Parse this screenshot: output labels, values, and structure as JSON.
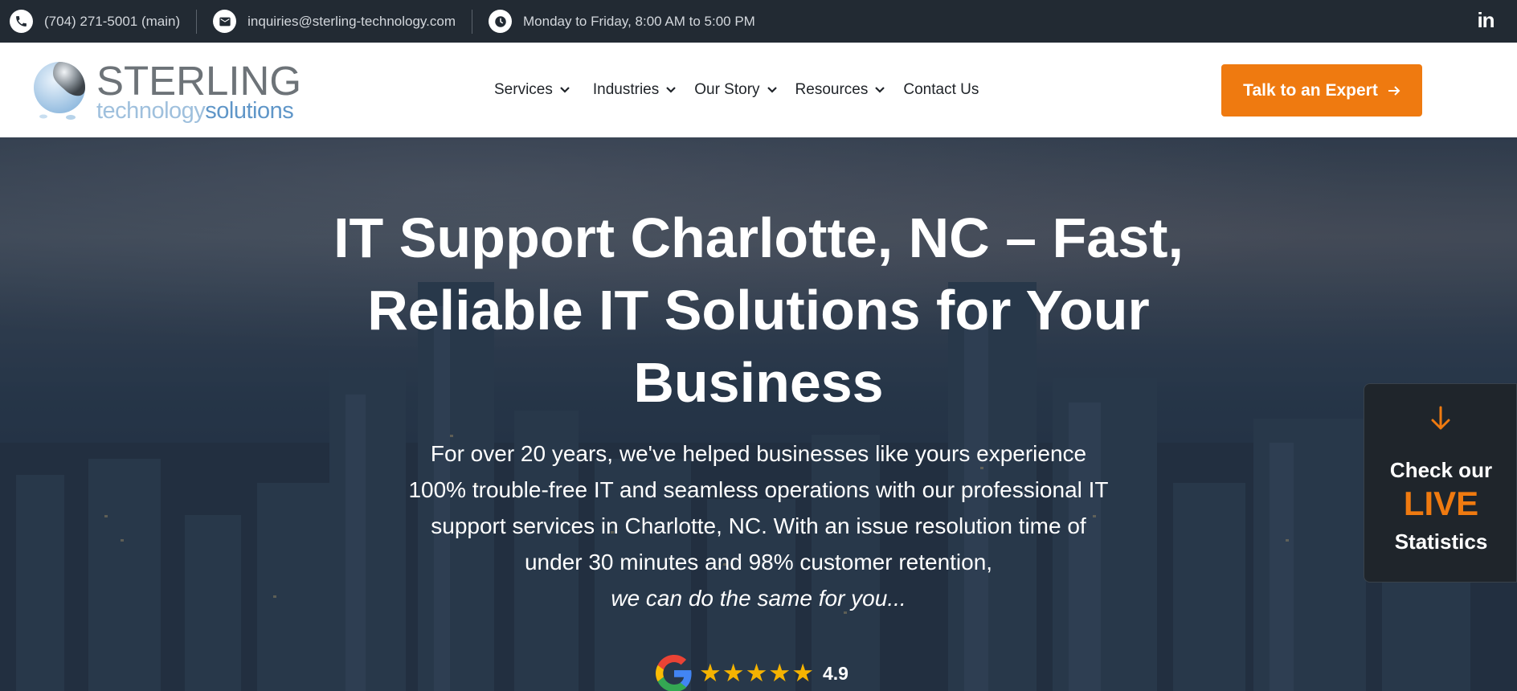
{
  "topbar": {
    "phone": "(704) 271-5001 (main)",
    "email": "inquiries@sterling-technology.com",
    "hours": "Monday to Friday, 8:00 AM to 5:00 PM",
    "social_icon": "linkedin-icon"
  },
  "logo": {
    "line1": "STERLING",
    "line2a": "technology",
    "line2b": "solutions"
  },
  "nav": {
    "items": [
      {
        "label": "Services",
        "dropdown": true
      },
      {
        "label": "Industries",
        "dropdown": true
      },
      {
        "label": "Our Story",
        "dropdown": true
      },
      {
        "label": "Resources",
        "dropdown": true
      },
      {
        "label": "Contact Us",
        "dropdown": false
      }
    ],
    "cta_label": "Talk to an Expert"
  },
  "hero": {
    "title": "IT Support Charlotte, NC – Fast, Reliable IT Solutions for Your Business",
    "body": "For over 20 years, we've helped businesses like yours experience 100% trouble-free IT and seamless operations with our professional IT support services in Charlotte, NC. With an issue resolution time of under 30 minutes and 98% customer retention,",
    "body_em": "we can do the same for you...",
    "rating_value": "4.9",
    "rating_stars": 5
  },
  "live_tab": {
    "line1": "Check our",
    "line2": "LIVE",
    "line3": "Statistics"
  },
  "colors": {
    "accent": "#ef7a10",
    "topbar": "#222a33",
    "star": "#f5b301"
  }
}
